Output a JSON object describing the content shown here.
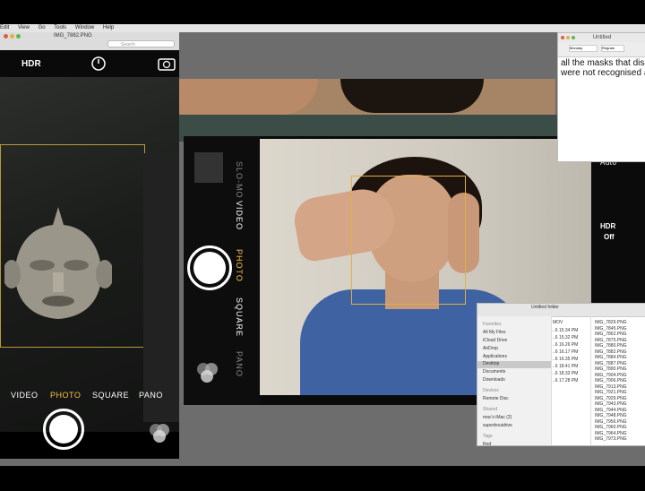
{
  "menubar": {
    "items": [
      "Edit",
      "View",
      "Go",
      "Tools",
      "Window",
      "Help"
    ]
  },
  "preview": {
    "title": "IMG_7882.PNG",
    "search_placeholder": "Search"
  },
  "left_phone": {
    "hdr": "HDR",
    "modes": [
      "VIDEO",
      "PHOTO",
      "SQUARE",
      "PANO"
    ]
  },
  "center_phone": {
    "modes": [
      "SLO-MO",
      "VIDEO",
      "PHOTO",
      "SQUARE",
      "PANO"
    ]
  },
  "right_controls": {
    "auto": "Auto",
    "hdr": "HDR",
    "hdr_state": "Off"
  },
  "textedit": {
    "title": "Untitled",
    "font": "Monday",
    "style": "Regular",
    "lines": [
      "all the masks that disappe",
      "were not recognised as th"
    ]
  },
  "finder": {
    "title": "Untitled folder",
    "favorites_label": "Favorites",
    "favorites": [
      "All My Files",
      "iCloud Drive",
      "AirDrop",
      "Applications",
      "Desktop",
      "Documents",
      "Downloads"
    ],
    "devices_label": "Devices",
    "devices": [
      "Remote Disc"
    ],
    "shared_label": "Shared",
    "shared": [
      "mac's iMac (2)",
      "superbouidrive"
    ],
    "tags_label": "Tags",
    "tags": [
      "Red"
    ],
    "mid_header": "MOV",
    "times": [
      "..6 15.34 PM",
      "..6 15.32 PM",
      "..6 16.26 PM",
      "..6 16.17 PM",
      "..6 16.35 PM",
      "..6 18.41 PM",
      "..6 18.33 PM",
      "..6 17.28 PM"
    ],
    "files": [
      "IMG_7829.PNG",
      "IMG_7845.PNG",
      "IMG_7862.PNG",
      "IMG_7875.PNG",
      "IMG_7880.PNG",
      "IMG_7882.PNG",
      "IMG_7884.PNG",
      "IMG_7887.PNG",
      "IMG_7890.PNG",
      "IMG_7904.PNG",
      "IMG_7906.PNG",
      "IMG_7913.PNG",
      "IMG_7921.PNG",
      "IMG_7929.PNG",
      "IMG_7943.PNG",
      "IMG_7944.PNG",
      "IMG_7948.PNG",
      "IMG_7956.PNG",
      "IMG_7960.PNG",
      "IMG_7964.PNG",
      "IMG_7973.PNG"
    ]
  }
}
